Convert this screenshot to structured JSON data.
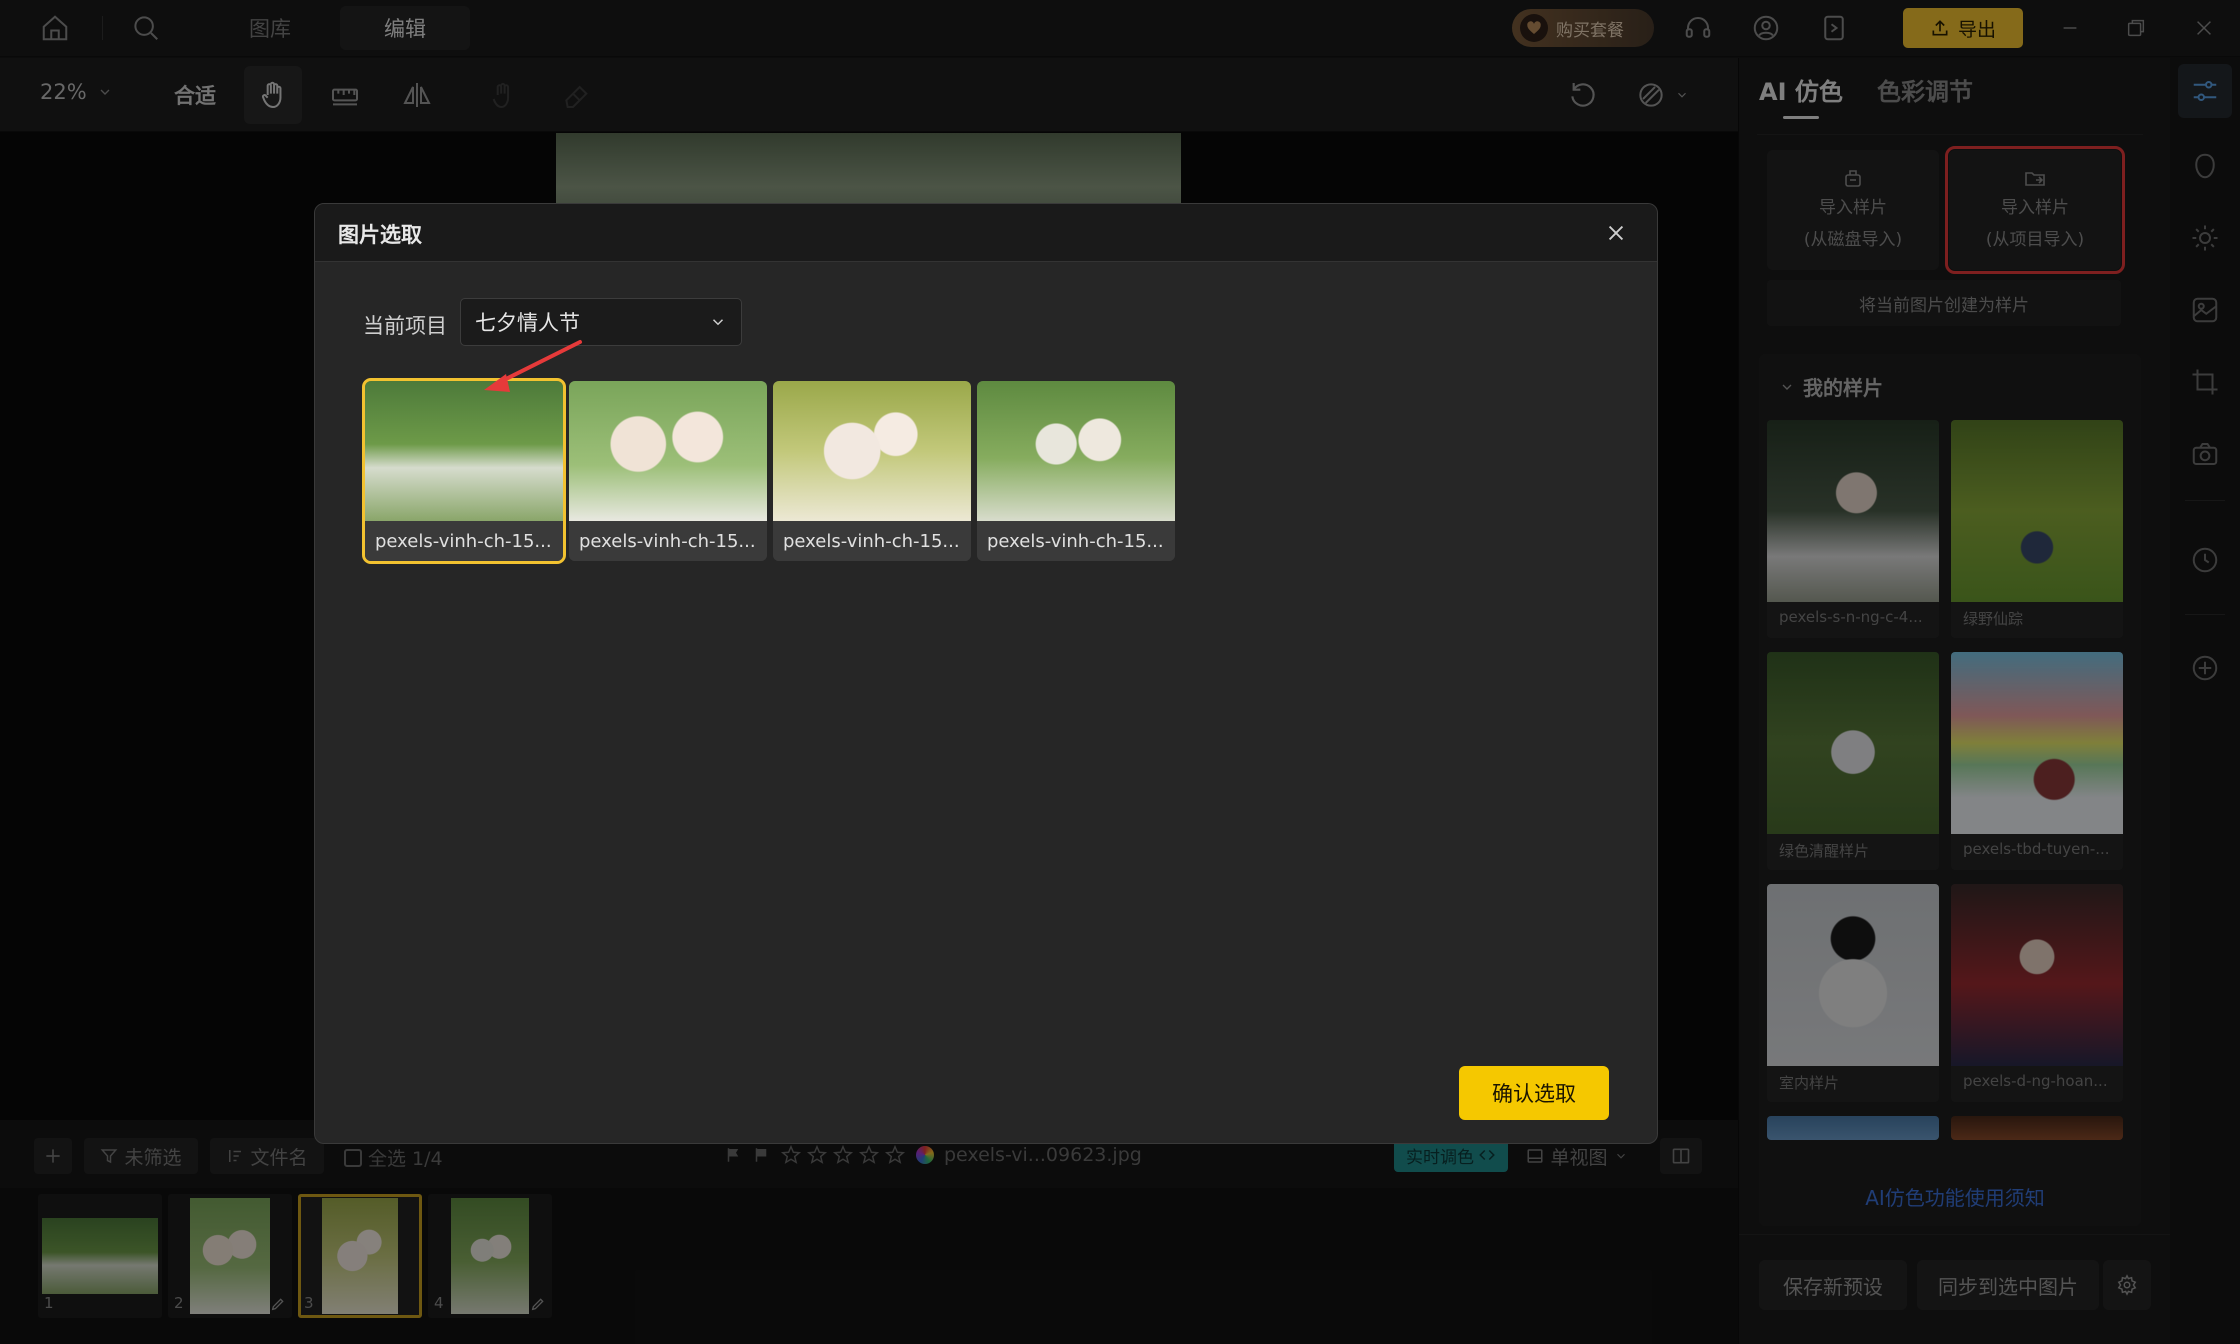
{
  "top": {
    "tabs": [
      "图库",
      "编辑"
    ],
    "active_tab": "编辑",
    "buy_label": "购买套餐",
    "export_label": "导出"
  },
  "toolbar": {
    "zoom": "22%",
    "fit_label": "合适"
  },
  "right_panel": {
    "tab_ai": "AI 仿色",
    "tab_color": "色彩调节",
    "import_disk_line1": "导入样片",
    "import_disk_line2": "(从磁盘导入)",
    "import_project_line1": "导入样片",
    "import_project_line2": "(从项目导入)",
    "create_sample": "将当前图片创建为样片",
    "my_samples_title": "我的样片",
    "samples": [
      {
        "name": "pexels-s-n-ng-c-4..."
      },
      {
        "name": "绿野仙踪"
      },
      {
        "name": "绿色清醒样片"
      },
      {
        "name": "pexels-tbd-tuyen-..."
      },
      {
        "name": "室内样片"
      },
      {
        "name": "pexels-d-ng-hoan..."
      }
    ],
    "ai_notice": "AI仿色功能使用须知",
    "save_preset": "保存新预设",
    "sync_selected": "同步到选中图片"
  },
  "bottom": {
    "filter_label": "未筛选",
    "sort_label": "文件名",
    "select_all": "全选 1/4",
    "filename": "pexels-vi...09623.jpg",
    "realtime_label": "实时调色",
    "view_label": "单视图",
    "film": [
      "1",
      "2",
      "3",
      "4"
    ]
  },
  "modal": {
    "title": "图片选取",
    "project_label": "当前项目",
    "project_value": "七夕情人节",
    "images": [
      {
        "name": "pexels-vinh-ch-15..."
      },
      {
        "name": "pexels-vinh-ch-15..."
      },
      {
        "name": "pexels-vinh-ch-15..."
      },
      {
        "name": "pexels-vinh-ch-15..."
      }
    ],
    "confirm_label": "确认选取"
  },
  "colors": {
    "accent_yellow": "#f5c800",
    "highlight_red": "#e63a3a",
    "link_blue": "#3b6fd8",
    "active_strip_blue": "#5aa0e6"
  }
}
